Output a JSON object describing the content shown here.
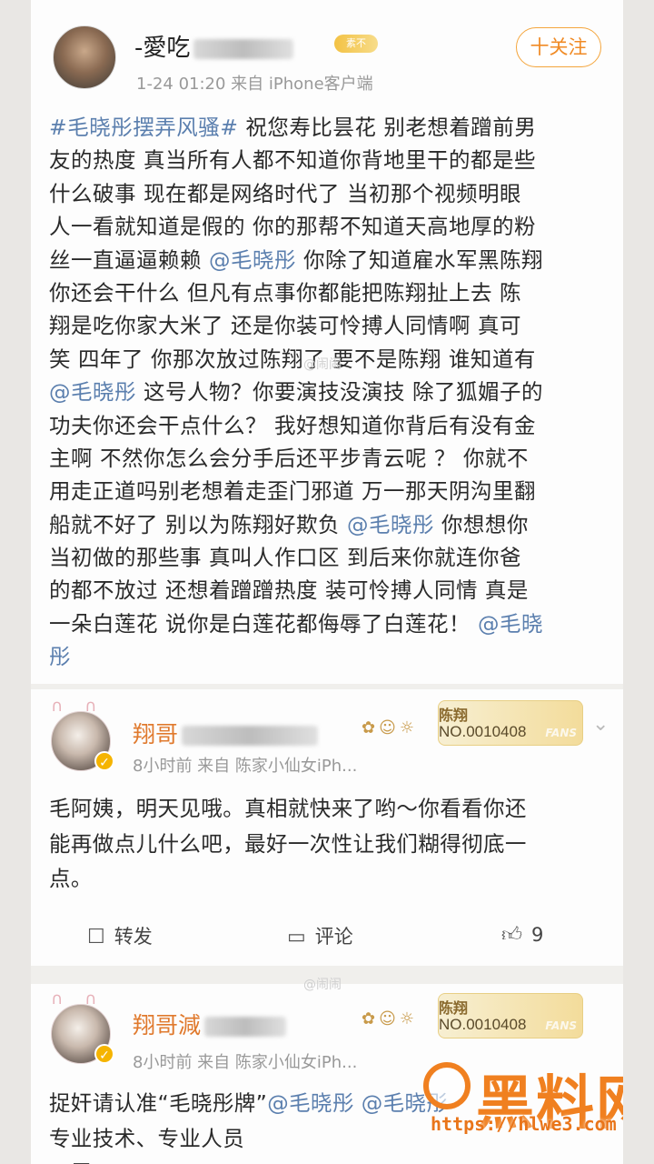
{
  "post": {
    "author": "-愛吃",
    "badge": "素不",
    "meta": "1-24 01:20   来自 iPhone客户端",
    "follow": "十关注",
    "lines": [
      [
        {
          "t": "#毛晓彤摆弄风骚#",
          "link": true
        },
        {
          "t": " 祝您寿比昙花 别老想着蹭前男"
        }
      ],
      [
        {
          "t": "友的热度 真当所有人都不知道你背地里干的都是些"
        }
      ],
      [
        {
          "t": "什么破事 现在都是网络时代了 当初那个视频明眼"
        }
      ],
      [
        {
          "t": "人一看就知道是假的 你的那帮不知道天高地厚的粉"
        }
      ],
      [
        {
          "t": "丝一直逼逼赖赖 "
        },
        {
          "t": "@毛晓彤",
          "link": true
        },
        {
          "t": " 你除了知道雇水军黑陈翔"
        }
      ],
      [
        {
          "t": "你还会干什么 但凡有点事你都能把陈翔扯上去 陈"
        }
      ],
      [
        {
          "t": "翔是吃你家大米了 还是你装可怜搏人同情啊 真可"
        }
      ],
      [
        {
          "t": "笑 四年了 你那次放过陈翔了 要不是陈翔 谁知道有"
        }
      ],
      [
        {
          "t": "@毛晓彤",
          "link": true
        },
        {
          "t": " 这号人物？你要演技没演技 除了狐媚子的"
        }
      ],
      [
        {
          "t": "功夫你还会干点什么？ 我好想知道你背后有没有金"
        }
      ],
      [
        {
          "t": "主啊 不然你怎么会分手后还平步青云呢 ？ 你就不"
        }
      ],
      [
        {
          "t": "用走正道吗别老想着走歪门邪道 万一那天阴沟里翻"
        }
      ],
      [
        {
          "t": "船就不好了 别以为陈翔好欺负 "
        },
        {
          "t": "@毛晓彤",
          "link": true
        },
        {
          "t": " 你想想你"
        }
      ],
      [
        {
          "t": "当初做的那些事 真叫人作口区  到后来你就连你爸"
        }
      ],
      [
        {
          "t": "的都不放过 还想着蹭蹭热度 装可怜搏人同情 真是"
        }
      ],
      [
        {
          "t": "一朵白莲花 说你是白莲花都侮辱了白莲花！ "
        },
        {
          "t": "@毛晓",
          "link": true
        }
      ],
      [
        {
          "t": "彤",
          "link": true
        }
      ]
    ]
  },
  "comments": [
    {
      "name": "翔哥",
      "fans_name": "陈翔",
      "fans_no": "NO.0010408",
      "fans_logo": "FANS",
      "meta": "8小时前   来自 陈家小仙女iPh...",
      "lines": [
        "毛阿姨，明天见哦。真相就快来了哟～你看看你还",
        "能再做点儿什么吧，最好一次性让我们糊得彻底一",
        "点。"
      ]
    },
    {
      "name": "翔哥減",
      "fans_name": "陈翔",
      "fans_no": "NO.0010408",
      "fans_logo": "FANS",
      "meta": "8小时前   来自 陈家小仙女iPh...",
      "lines": [
        [
          {
            "t": "捉奸请认准“毛晓彤牌”"
          },
          {
            "t": "@毛晓彤",
            "link": true
          },
          {
            "t": " @毛晓彤",
            "link": true
          }
        ],
        [
          {
            "t": "专业技术、专业人员"
          }
        ],
        [
          {
            "t": "只需"
          }
        ]
      ]
    }
  ],
  "actions": {
    "repost": "转发",
    "comment": "评论",
    "like_count": "9"
  },
  "watermark": {
    "brand": "黑料网",
    "url": "https://hlwe3.com"
  },
  "faint_mark": "@闹闹"
}
